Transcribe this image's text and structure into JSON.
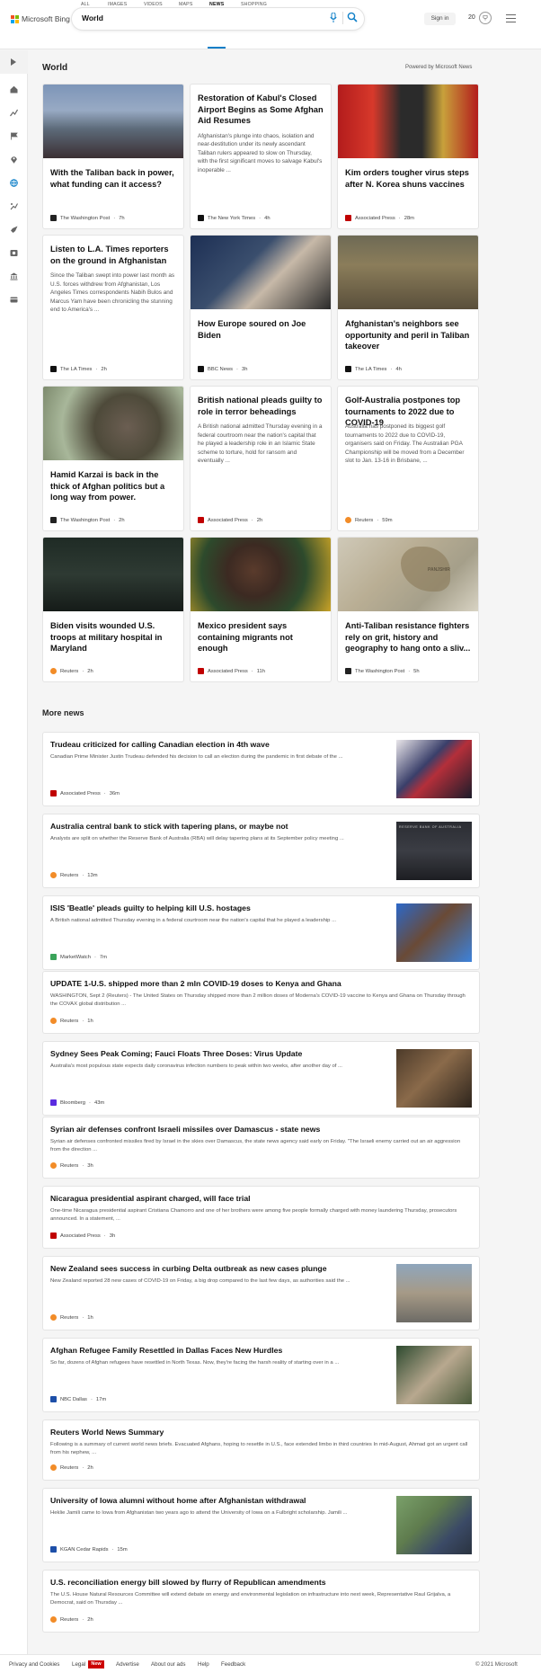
{
  "header": {
    "logo_text": "Microsoft Bing",
    "search_value": "World",
    "signin_label": "Sign in",
    "rewards_count": "20"
  },
  "tabs": [
    "ALL",
    "IMAGES",
    "VIDEOS",
    "MAPS",
    "NEWS",
    "SHOPPING"
  ],
  "active_tab": "NEWS",
  "section": {
    "title": "World",
    "powered_by": "Powered by Microsoft News"
  },
  "cards": [
    {
      "title": "With the Taliban back in power, what funding can it access?",
      "snippet": "",
      "source": "The Washington Post",
      "time": "7h",
      "has_image": true
    },
    {
      "title": "Restoration of Kabul's Closed Airport Begins as Some Afghan Aid Resumes",
      "snippet": "Afghanistan's plunge into chaos, isolation and near-destitution under its newly ascendant Taliban rulers appeared to slow on Thursday, with the first significant moves to salvage Kabul's inoperable ...",
      "source": "The New York Times",
      "time": "4h",
      "has_image": false
    },
    {
      "title": "Kim orders tougher virus steps after N. Korea shuns vaccines",
      "snippet": "",
      "source": "Associated Press",
      "time": "28m",
      "has_image": true
    },
    {
      "title": "Listen to L.A. Times reporters on the ground in Afghanistan",
      "snippet": "Since the Taliban swept into power last month as U.S. forces withdrew from Afghanistan, Los Angeles Times correspondents Nabih Bulos and Marcus Yam have been chronicling the stunning end to America's ...",
      "source": "The LA Times",
      "time": "2h",
      "has_image": false
    },
    {
      "title": "How Europe soured on Joe Biden",
      "snippet": "",
      "source": "BBC News",
      "time": "3h",
      "has_image": true
    },
    {
      "title": "Afghanistan's neighbors see opportunity and peril in Taliban takeover",
      "snippet": "",
      "source": "The LA Times",
      "time": "4h",
      "has_image": true
    },
    {
      "title": "Hamid Karzai is back in the thick of Afghan politics but a long way from power.",
      "snippet": "",
      "source": "The Washington Post",
      "time": "2h",
      "has_image": true
    },
    {
      "title": "British national pleads guilty to role in terror beheadings",
      "snippet": "A British national admitted Thursday evening in a federal courtroom near the nation's capital that he played a leadership role in an Islamic State scheme to torture, hold for ransom and eventually ...",
      "source": "Associated Press",
      "time": "2h",
      "has_image": false
    },
    {
      "title": "Golf-Australia postpones top tournaments to 2022 due to COVID-19",
      "snippet": "Australia has postponed its biggest golf tournaments to 2022 due to COVID-19, organisers said on Friday. The Australian PGA Championship will be moved from a December slot to Jan. 13-16 in Brisbane, ...",
      "source": "Reuters",
      "time": "59m",
      "has_image": false
    },
    {
      "title": "Biden visits wounded U.S. troops at military hospital in Maryland",
      "snippet": "",
      "source": "Reuters",
      "time": "2h",
      "has_image": true
    },
    {
      "title": "Mexico president says containing migrants not enough",
      "snippet": "",
      "source": "Associated Press",
      "time": "11h",
      "has_image": true
    },
    {
      "title": "Anti-Taliban resistance fighters rely on grit, history and geography to hang onto a sliv...",
      "snippet": "",
      "source": "The Washington Post",
      "time": "5h",
      "has_image": true,
      "map_label": "PANJSHIR"
    }
  ],
  "more_news": {
    "title": "More news",
    "items": [
      {
        "title": "Trudeau criticized for calling Canadian election in 4th wave",
        "snippet": "Canadian Prime Minister Justin Trudeau defended his decision to call an election during the pandemic in first debate of the ...",
        "source": "Associated Press",
        "time": "36m",
        "has_image": true
      },
      {
        "title": "Australia central bank to stick with tapering plans, or maybe not",
        "snippet": "Analysts are split on whether the Reserve Bank of Australia (RBA) will delay tapering plans at its September policy meeting ...",
        "source": "Reuters",
        "time": "13m",
        "has_image": true,
        "image_caption": "RESERVE BANK OF AUSTRALIA"
      },
      {
        "title": "ISIS 'Beatle' pleads guilty to helping kill U.S. hostages",
        "snippet": "A British national admitted Thursday evening in a federal courtroom near the nation's capital that he played a leadership ...",
        "source": "MarketWatch",
        "time": "7m",
        "has_image": true
      },
      {
        "title": "UPDATE 1-U.S. shipped more than 2 mln COVID-19 doses to Kenya and Ghana",
        "snippet": "WASHINGTON, Sept 2 (Reuters) - The United States on Thursday shipped more than 2 million doses of Moderna's COVID-19 vaccine to Kenya and Ghana on Thursday through the COVAX global distribution ...",
        "source": "Reuters",
        "time": "1h",
        "has_image": false
      },
      {
        "title": "Sydney Sees Peak Coming; Fauci Floats Three Doses: Virus Update",
        "snippet": "Australia's most populous state expects daily coronavirus infection numbers to peak within two weeks, after another day of ...",
        "source": "Bloomberg",
        "time": "43m",
        "has_image": true
      },
      {
        "title": "Syrian air defenses confront Israeli missiles over Damascus - state news",
        "snippet": "Syrian air defenses confronted missiles fired by Israel in the skies over Damascus, the state news agency said early on Friday. \"The Israeli enemy carried out an air aggression from the direction ...",
        "source": "Reuters",
        "time": "3h",
        "has_image": false
      },
      {
        "title": "Nicaragua presidential aspirant charged, will face trial",
        "snippet": "One-time Nicaragua presidential aspirant Cristiana Chamorro and one of her brothers were among five people formally charged with money laundering Thursday, prosecutors announced. In a statement, ...",
        "source": "Associated Press",
        "time": "3h",
        "has_image": false
      },
      {
        "title": "New Zealand sees success in curbing Delta outbreak as new cases plunge",
        "snippet": "New Zealand reported 28 new cases of COVID-19 on Friday, a big drop compared to the last few days, as authorities said the ...",
        "source": "Reuters",
        "time": "1h",
        "has_image": true
      },
      {
        "title": "Afghan Refugee Family Resettled in Dallas Faces New Hurdles",
        "snippet": "So far, dozens of Afghan refugees have resettled in North Texas. Now, they're facing the harsh reality of starting over in a ...",
        "source": "NBC Dallas",
        "time": "17m",
        "has_image": true
      },
      {
        "title": "Reuters World News Summary",
        "snippet": "Following is a summary of current world news briefs. Evacuated Afghans, hoping to resettle in U.S., face extended limbo in third countries In mid-August, Ahmad got an urgent call from his nephew, ...",
        "source": "Reuters",
        "time": "2h",
        "has_image": false
      },
      {
        "title": "University of Iowa alumni without home after Afghanistan withdrawal",
        "snippet": "Heklie Jamili came to Iowa from Afghanistan two years ago to attend the University of Iowa on a Fulbright scholarship. Jamili ...",
        "source": "KGAN Cedar Rapids",
        "time": "15m",
        "has_image": true
      },
      {
        "title": "U.S. reconciliation energy bill slowed by flurry of Republican amendments",
        "snippet": "The U.S. House Natural Resources Committee will extend debate on energy and environmental legislation on infrastructure into next week, Representative Raul Grijalva, a Democrat, said on Thursday ...",
        "source": "Reuters",
        "time": "2h",
        "has_image": false
      }
    ]
  },
  "footer": {
    "links": [
      "Privacy and Cookies",
      "Legal",
      "Advertise",
      "About our ads",
      "Help",
      "Feedback"
    ],
    "new_badge": "New",
    "copyright": "© 2021 Microsoft"
  },
  "colors": {
    "accent": "#0c7ec7",
    "ms_red": "#f25022",
    "ms_green": "#7fba00",
    "ms_blue": "#00a4ef",
    "ms_yellow": "#ffb900",
    "reuters": "#f28c28",
    "ap": "#c00000",
    "bloomberg": "#5a2be0"
  }
}
